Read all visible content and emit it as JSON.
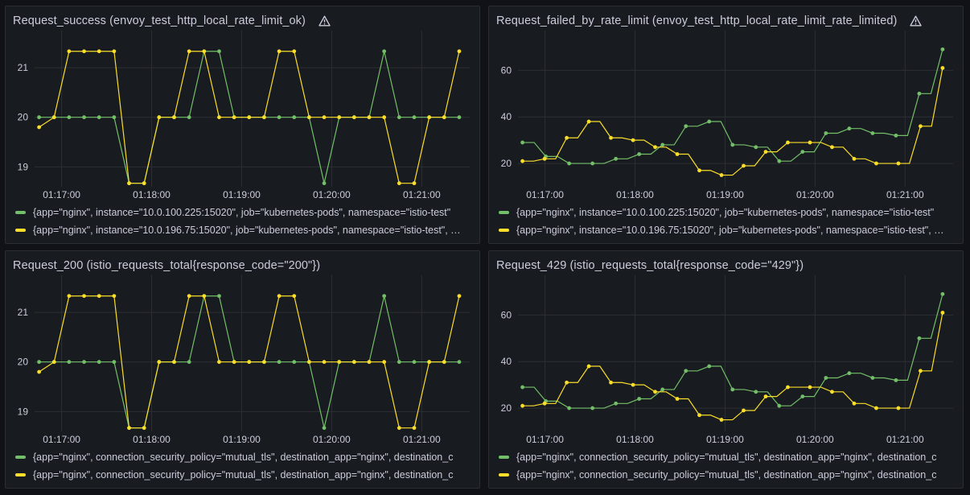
{
  "colors": {
    "green": "#73bf69",
    "yellow": "#fade2a",
    "grid": "#2c2f35",
    "axis_text": "#ccccdc"
  },
  "chart_data": [
    {
      "type": "line",
      "title": "Request_success (envoy_test_http_local_rate_limit_ok)",
      "warning_icon": "warning-triangle-icon",
      "x": [
        "01:16:45",
        "01:16:55",
        "01:17:05",
        "01:17:15",
        "01:17:25",
        "01:17:35",
        "01:17:45",
        "01:17:55",
        "01:18:05",
        "01:18:15",
        "01:18:25",
        "01:18:35",
        "01:18:45",
        "01:18:55",
        "01:19:05",
        "01:19:15",
        "01:19:25",
        "01:19:35",
        "01:19:45",
        "01:19:55",
        "01:20:05",
        "01:20:15",
        "01:20:25",
        "01:20:35",
        "01:20:45",
        "01:20:55",
        "01:21:05",
        "01:21:15",
        "01:21:25"
      ],
      "x_ticks": [
        "01:17:00",
        "01:18:00",
        "01:19:00",
        "01:20:00",
        "01:21:00"
      ],
      "y_ticks": [
        19,
        20,
        21
      ],
      "ylim": [
        18.6,
        21.65
      ],
      "series": [
        {
          "name": "{app=\"nginx\", instance=\"10.0.100.225:15020\", job=\"kubernetes-pods\", namespace=\"istio-test\"",
          "color": "green",
          "values": [
            20,
            20,
            20,
            20,
            20,
            20,
            18.67,
            18.67,
            20,
            20,
            20,
            21.33,
            21.33,
            20,
            20,
            20,
            20,
            20,
            20,
            18.67,
            20,
            20,
            20,
            21.33,
            20,
            20,
            20,
            20,
            20
          ]
        },
        {
          "name": "{app=\"nginx\", instance=\"10.0.196.75:15020\", job=\"kubernetes-pods\", namespace=\"istio-test\", …",
          "color": "yellow",
          "values": [
            19.8,
            20,
            21.33,
            21.33,
            21.33,
            21.33,
            18.67,
            18.67,
            20,
            20,
            21.33,
            21.33,
            20,
            20,
            20,
            20,
            21.33,
            21.33,
            20,
            20,
            20,
            20,
            20,
            20,
            18.67,
            18.67,
            20,
            20,
            21.33
          ]
        }
      ]
    },
    {
      "type": "line",
      "title": "Request_failed_by_rate_limit (envoy_test_http_local_rate_limit_rate_limited)",
      "warning_icon": "warning-triangle-icon",
      "x": [
        "01:16:45",
        "01:16:55",
        "01:17:05",
        "01:17:15",
        "01:17:25",
        "01:17:35",
        "01:17:45",
        "01:17:55",
        "01:18:05",
        "01:18:15",
        "01:18:25",
        "01:18:35",
        "01:18:45",
        "01:18:55",
        "01:19:05",
        "01:19:15",
        "01:19:25",
        "01:19:35",
        "01:19:45",
        "01:19:55",
        "01:20:05",
        "01:20:15",
        "01:20:25",
        "01:20:35",
        "01:20:45",
        "01:20:55",
        "01:21:05",
        "01:21:15",
        "01:21:25"
      ],
      "x_ticks": [
        "01:17:00",
        "01:18:00",
        "01:19:00",
        "01:20:00",
        "01:21:00"
      ],
      "y_ticks": [
        20,
        40,
        60
      ],
      "ylim": [
        10,
        75
      ],
      "series": [
        {
          "name": "{app=\"nginx\", instance=\"10.0.100.225:15020\", job=\"kubernetes-pods\", namespace=\"istio-test\"",
          "color": "green",
          "values": [
            29,
            29,
            23,
            23,
            20,
            20,
            20,
            20,
            22,
            22,
            24,
            24,
            28,
            28,
            36,
            36,
            38,
            38,
            28,
            28,
            27,
            27,
            21,
            21,
            25,
            25,
            33,
            33,
            35,
            35,
            33,
            33,
            32,
            32,
            50,
            50,
            69
          ]
        },
        {
          "name": "{app=\"nginx\", instance=\"10.0.196.75:15020\", job=\"kubernetes-pods\", namespace=\"istio-test\", …",
          "color": "yellow",
          "values": [
            21,
            21,
            22,
            22,
            31,
            31,
            38,
            38,
            31,
            31,
            30,
            30,
            27,
            27,
            24,
            24,
            17,
            17,
            15,
            15,
            19,
            19,
            25,
            25,
            29,
            29,
            29,
            29,
            27,
            27,
            22,
            22,
            20,
            20,
            20,
            20,
            36,
            36,
            61
          ]
        }
      ]
    },
    {
      "type": "line",
      "title": "Request_200 (istio_requests_total{response_code=\"200\"})",
      "x": [
        "01:16:45",
        "01:16:55",
        "01:17:05",
        "01:17:15",
        "01:17:25",
        "01:17:35",
        "01:17:45",
        "01:17:55",
        "01:18:05",
        "01:18:15",
        "01:18:25",
        "01:18:35",
        "01:18:45",
        "01:18:55",
        "01:19:05",
        "01:19:15",
        "01:19:25",
        "01:19:35",
        "01:19:45",
        "01:19:55",
        "01:20:05",
        "01:20:15",
        "01:20:25",
        "01:20:35",
        "01:20:45",
        "01:20:55",
        "01:21:05",
        "01:21:15",
        "01:21:25"
      ],
      "x_ticks": [
        "01:17:00",
        "01:18:00",
        "01:19:00",
        "01:20:00",
        "01:21:00"
      ],
      "y_ticks": [
        19,
        20,
        21
      ],
      "ylim": [
        18.6,
        21.65
      ],
      "series": [
        {
          "name": "{app=\"nginx\", connection_security_policy=\"mutual_tls\", destination_app=\"nginx\", destination_c",
          "color": "green",
          "values": [
            20,
            20,
            20,
            20,
            20,
            20,
            18.67,
            18.67,
            20,
            20,
            20,
            21.33,
            21.33,
            20,
            20,
            20,
            20,
            20,
            20,
            18.67,
            20,
            20,
            20,
            21.33,
            20,
            20,
            20,
            20,
            20
          ]
        },
        {
          "name": "{app=\"nginx\", connection_security_policy=\"mutual_tls\", destination_app=\"nginx\", destination_c",
          "color": "yellow",
          "values": [
            19.8,
            20,
            21.33,
            21.33,
            21.33,
            21.33,
            18.67,
            18.67,
            20,
            20,
            21.33,
            21.33,
            20,
            20,
            20,
            20,
            21.33,
            21.33,
            20,
            20,
            20,
            20,
            20,
            20,
            18.67,
            18.67,
            20,
            20,
            21.33
          ]
        }
      ]
    },
    {
      "type": "line",
      "title": "Request_429 (istio_requests_total{response_code=\"429\"})",
      "x": [
        "01:16:45",
        "01:16:55",
        "01:17:05",
        "01:17:15",
        "01:17:25",
        "01:17:35",
        "01:17:45",
        "01:17:55",
        "01:18:05",
        "01:18:15",
        "01:18:25",
        "01:18:35",
        "01:18:45",
        "01:18:55",
        "01:19:05",
        "01:19:15",
        "01:19:25",
        "01:19:35",
        "01:19:45",
        "01:19:55",
        "01:20:05",
        "01:20:15",
        "01:20:25",
        "01:20:35",
        "01:20:45",
        "01:20:55",
        "01:21:05",
        "01:21:15",
        "01:21:25"
      ],
      "x_ticks": [
        "01:17:00",
        "01:18:00",
        "01:19:00",
        "01:20:00",
        "01:21:00"
      ],
      "y_ticks": [
        20,
        40,
        60
      ],
      "ylim": [
        10,
        75
      ],
      "series": [
        {
          "name": "{app=\"nginx\", connection_security_policy=\"mutual_tls\", destination_app=\"nginx\", destination_c",
          "color": "green",
          "values": [
            29,
            29,
            23,
            23,
            20,
            20,
            20,
            20,
            22,
            22,
            24,
            24,
            28,
            28,
            36,
            36,
            38,
            38,
            28,
            28,
            27,
            27,
            21,
            21,
            25,
            25,
            33,
            33,
            35,
            35,
            33,
            33,
            32,
            32,
            50,
            50,
            69
          ]
        },
        {
          "name": "{app=\"nginx\", connection_security_policy=\"mutual_tls\", destination_app=\"nginx\", destination_c",
          "color": "yellow",
          "values": [
            21,
            21,
            22,
            22,
            31,
            31,
            38,
            38,
            31,
            31,
            30,
            30,
            27,
            27,
            24,
            24,
            17,
            17,
            15,
            15,
            19,
            19,
            25,
            25,
            29,
            29,
            29,
            29,
            27,
            27,
            22,
            22,
            20,
            20,
            20,
            20,
            36,
            36,
            61
          ]
        }
      ]
    }
  ]
}
